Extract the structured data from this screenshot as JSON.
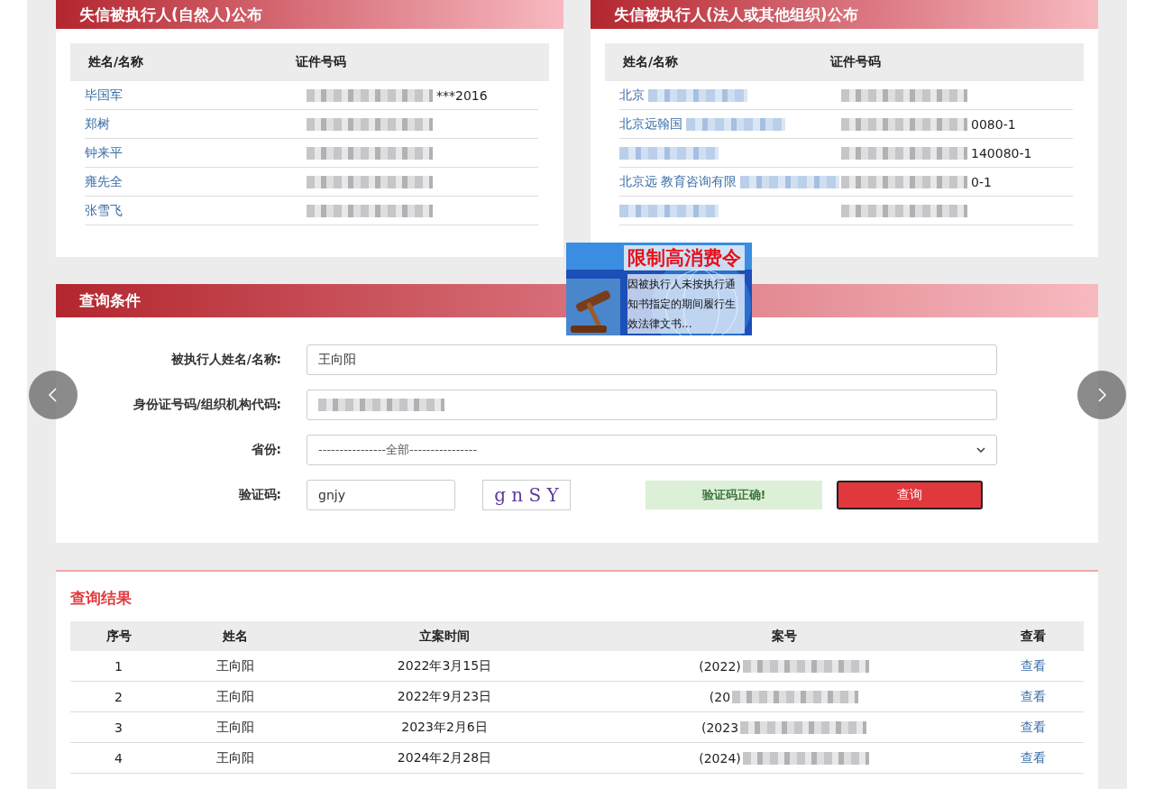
{
  "person_panel": {
    "title": "失信被执行人(自然人)公布",
    "columns": [
      "姓名/名称",
      "证件号码"
    ],
    "rows": [
      {
        "name": "毕国军",
        "id_visible": "***2016"
      },
      {
        "name": "郑树"
      },
      {
        "name": "钟来平"
      },
      {
        "name": "雍先全"
      },
      {
        "name": "张雪飞"
      }
    ]
  },
  "org_panel": {
    "title": "失信被执行人(法人或其他组织)公布",
    "columns": [
      "姓名/名称",
      "证件号码"
    ],
    "rows": [
      {
        "name": "北京"
      },
      {
        "name": "北京远翰国",
        "id_visible": "0080-1"
      },
      {
        "name": "",
        "id_visible": "140080-1"
      },
      {
        "name": "北京远 教育咨询有限",
        "id_visible": "0-1"
      },
      {
        "name": ""
      }
    ]
  },
  "banner": {
    "kind": "picture",
    "headline": "限制高消费令",
    "text": "因被执行人未按执行通知书指定的期间履行生效法律文书..."
  },
  "query": {
    "title": "查询条件",
    "fields": [
      {
        "kind": "input",
        "label": "被执行人姓名/名称:",
        "value": "王向阳"
      },
      {
        "kind": "masked",
        "label": "身份证号码/组织机构代码:"
      },
      {
        "kind": "select",
        "label": "省份:",
        "value": "----------------全部----------------"
      }
    ],
    "captcha": {
      "label": "验证码:",
      "value": "gnjy",
      "image_text": "g n S Y",
      "status": "验证码正确!"
    },
    "submit": "查询"
  },
  "results": {
    "title": "查询结果",
    "columns": [
      "序号",
      "姓名",
      "立案时间",
      "案号",
      "查看"
    ],
    "rows": [
      {
        "no": "1",
        "name": "王向阳",
        "date": "2022年3月15日",
        "case": "(2022)",
        "link": "查看"
      },
      {
        "no": "2",
        "name": "王向阳",
        "date": "2022年9月23日",
        "case": "(20",
        "link": "查看"
      },
      {
        "no": "3",
        "name": "王向阳",
        "date": "2023年2月6日",
        "case": "(2023",
        "link": "查看"
      },
      {
        "no": "4",
        "name": "王向阳",
        "date": "2024年2月28日",
        "case": "(2024)",
        "link": "查看"
      }
    ]
  }
}
